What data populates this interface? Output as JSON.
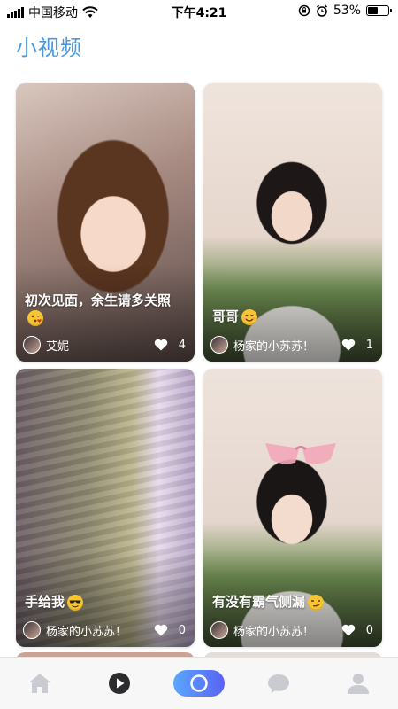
{
  "status_bar": {
    "carrier": "中国移动",
    "time": "下午4:21",
    "battery_percent": "53%",
    "battery_level": 0.53
  },
  "page_title": "小视频",
  "cards": [
    {
      "caption": "初次见面，余生请多关照",
      "emoji": "kissing-heart-face",
      "author": "艾妮",
      "likes": "4"
    },
    {
      "caption": "哥哥",
      "emoji": "smiling-face",
      "author": "杨家的小苏苏！",
      "likes": "1"
    },
    {
      "caption": "手给我",
      "emoji": "sunglasses-face",
      "author": "杨家的小苏苏！",
      "likes": "0"
    },
    {
      "caption": "有没有霸气侧漏",
      "emoji": "smirking-face",
      "author": "杨家的小苏苏！",
      "likes": "0"
    }
  ],
  "bottom_nav": {
    "items": [
      "home-icon",
      "play-circle-icon",
      "camera-circle-icon",
      "chat-bubble-icon",
      "profile-icon"
    ],
    "active_color": "#5a7cf7"
  },
  "colors": {
    "title": "#4a98e0",
    "nav_icon": "#c9cbd0",
    "pill_start": "#5aa7ff",
    "pill_end": "#5a62f5"
  }
}
